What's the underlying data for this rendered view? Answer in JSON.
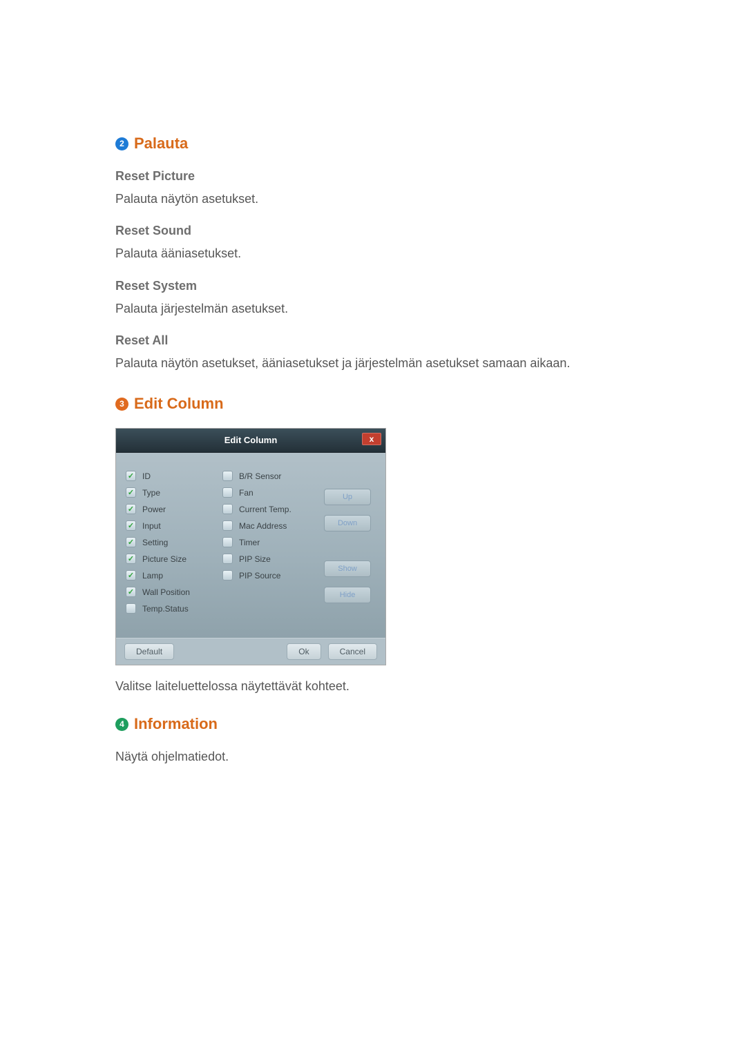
{
  "sections": {
    "s2": {
      "num": "2",
      "title": "Palauta"
    },
    "s3": {
      "num": "3",
      "title": "Edit Column"
    },
    "s4": {
      "num": "4",
      "title": "Information"
    }
  },
  "reset": {
    "picture_h": "Reset Picture",
    "picture_t": "Palauta näytön asetukset.",
    "sound_h": "Reset Sound",
    "sound_t": "Palauta ääniasetukset.",
    "system_h": "Reset System",
    "system_t": "Palauta järjestelmän asetukset.",
    "all_h": "Reset All",
    "all_t": "Palauta näytön asetukset, ääniasetukset ja järjestelmän asetukset samaan aikaan."
  },
  "dialog": {
    "title": "Edit Column",
    "close": "x",
    "left": [
      {
        "label": "ID",
        "checked": true
      },
      {
        "label": "Type",
        "checked": true
      },
      {
        "label": "Power",
        "checked": true
      },
      {
        "label": "Input",
        "checked": true
      },
      {
        "label": "Setting",
        "checked": true
      },
      {
        "label": "Picture Size",
        "checked": true
      },
      {
        "label": "Lamp",
        "checked": true
      },
      {
        "label": "Wall Position",
        "checked": true
      },
      {
        "label": "Temp.Status",
        "checked": false
      }
    ],
    "right": [
      {
        "label": "B/R Sensor",
        "checked": false
      },
      {
        "label": "Fan",
        "checked": false
      },
      {
        "label": "Current Temp.",
        "checked": false
      },
      {
        "label": "Mac Address",
        "checked": false
      },
      {
        "label": "Timer",
        "checked": false
      },
      {
        "label": "PIP Size",
        "checked": false
      },
      {
        "label": "PIP Source",
        "checked": false
      }
    ],
    "side": {
      "up": "Up",
      "down": "Down",
      "show": "Show",
      "hide": "Hide"
    },
    "footer": {
      "default": "Default",
      "ok": "Ok",
      "cancel": "Cancel"
    }
  },
  "edit_caption": "Valitse laiteluettelossa näytettävät kohteet.",
  "info_text": "Näytä ohjelmatiedot."
}
